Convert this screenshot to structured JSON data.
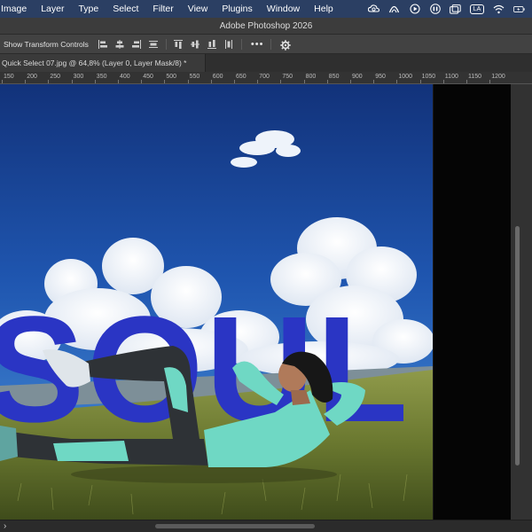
{
  "menubar": {
    "items": [
      "Image",
      "Layer",
      "Type",
      "Select",
      "Filter",
      "View",
      "Plugins",
      "Window",
      "Help"
    ],
    "status_icons": [
      "creative-cloud-icon",
      "arc-icon",
      "play-circle-icon",
      "airpods-icon",
      "window-icon",
      "input-source-icon",
      "wifi-icon",
      "battery-icon"
    ],
    "input_badge": "LA"
  },
  "titlebar": {
    "title": "Adobe Photoshop 2026"
  },
  "options": {
    "show_transform_label": "Show Transform Controls",
    "more_label": "•••"
  },
  "document": {
    "tab_title": "Quick Select 07.jpg @ 64,8% (Layer 0, Layer Mask/8) *",
    "ruler_ticks": [
      "150",
      "200",
      "250",
      "300",
      "350",
      "400",
      "450",
      "500",
      "550",
      "600",
      "650",
      "700",
      "750",
      "800",
      "850",
      "900",
      "950",
      "1000",
      "1050",
      "1100",
      "1150",
      "1200"
    ],
    "canvas_text": "SOUL",
    "text_color": "#2a35c4"
  },
  "colors": {
    "sky_top": "#14357a",
    "sky_bottom": "#3f86d6",
    "grass": "#6b7a36",
    "shirt": "#6fd8c4",
    "leggings": "#2e3236"
  }
}
